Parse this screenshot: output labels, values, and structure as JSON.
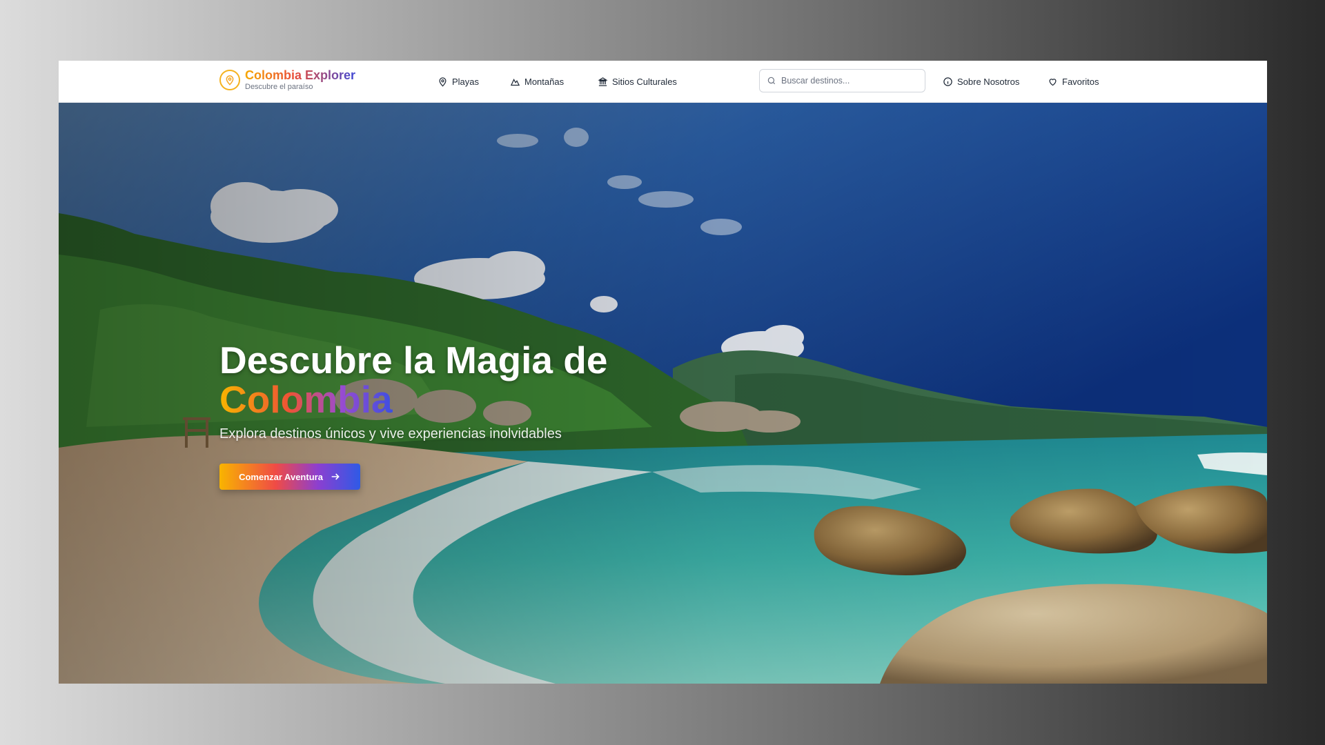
{
  "brand": {
    "title": "Colombia Explorer",
    "subtitle": "Descubre el paraíso",
    "icon": "map-pin-icon"
  },
  "nav": {
    "links": [
      {
        "label": "Playas",
        "icon": "map-pin-icon"
      },
      {
        "label": "Montañas",
        "icon": "mountain-icon"
      },
      {
        "label": "Sitios Culturales",
        "icon": "landmark-icon"
      }
    ],
    "search_placeholder": "Buscar destinos...",
    "about": {
      "label": "Sobre Nosotros",
      "icon": "info-icon"
    },
    "favorites": {
      "label": "Favoritos",
      "icon": "heart-icon"
    }
  },
  "hero": {
    "title_line1": "Descubre la Magia de",
    "title_line2": "Colombia",
    "subtitle": "Explora destinos únicos y vive experiencias inolvidables",
    "cta_label": "Comenzar Aventura",
    "cta_icon": "arrow-right-icon"
  },
  "colors": {
    "accent_yellow": "#f7b500",
    "accent_red": "#ee5335",
    "accent_purple": "#9a4bd0",
    "accent_blue": "#3d4fe0"
  }
}
